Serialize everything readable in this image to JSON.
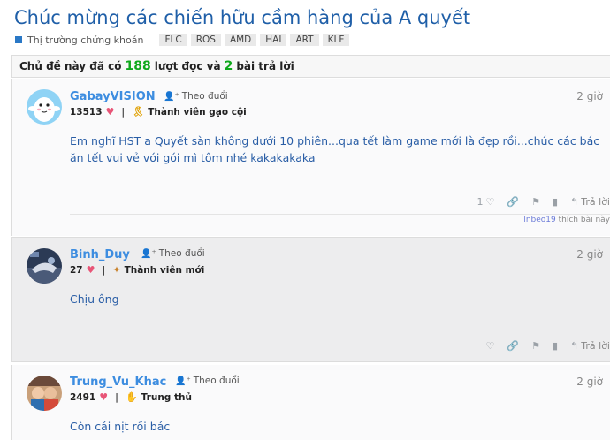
{
  "topic": {
    "title": "Chúc mừng các chiến hữu cầm hàng của A quyết",
    "category": "Thị trường chứng khoán",
    "category_color": "#2a78c6",
    "tags": [
      "FLC",
      "ROS",
      "AMD",
      "HAI",
      "ART",
      "KLF"
    ]
  },
  "stats": {
    "prefix": "Chủ đề này đã có",
    "views": "188",
    "views_label": "lượt đọc và",
    "replies": "2",
    "replies_label": "bài trả lời"
  },
  "posts": [
    {
      "username": "GabayVISION",
      "follow_label": "Theo đuổi",
      "time": "2 giờ",
      "score": "13513",
      "rank": "Thành viên gạo cội",
      "body": "Em nghĩ HST a Quyết sàn không dưới 10 phiên...qua tết làm game mới là đẹp rồi...chúc các bác ăn tết vui vẻ với gói mì tôm nhé kakakakaka",
      "like_count": "1",
      "reply_label": "Trả lời",
      "liked_by": "lnbeo19",
      "liked_suffix": "thích bài này"
    },
    {
      "username": "Binh_Duy",
      "follow_label": "Theo đuổi",
      "time": "2 giờ",
      "score": "27",
      "rank": "Thành viên mới",
      "body": "Chịu ông",
      "reply_label": "Trả lời"
    },
    {
      "username": "Trung_Vu_Khac",
      "follow_label": "Theo đuổi",
      "time": "2 giờ",
      "score": "2491",
      "rank": "Trung thủ",
      "body": "Còn cái nịt rồi bác"
    }
  ],
  "colors": {
    "title": "#1f5fa8",
    "username": "#3d8de0",
    "stat_number": "#0ea81b",
    "heart": "#e85577"
  }
}
